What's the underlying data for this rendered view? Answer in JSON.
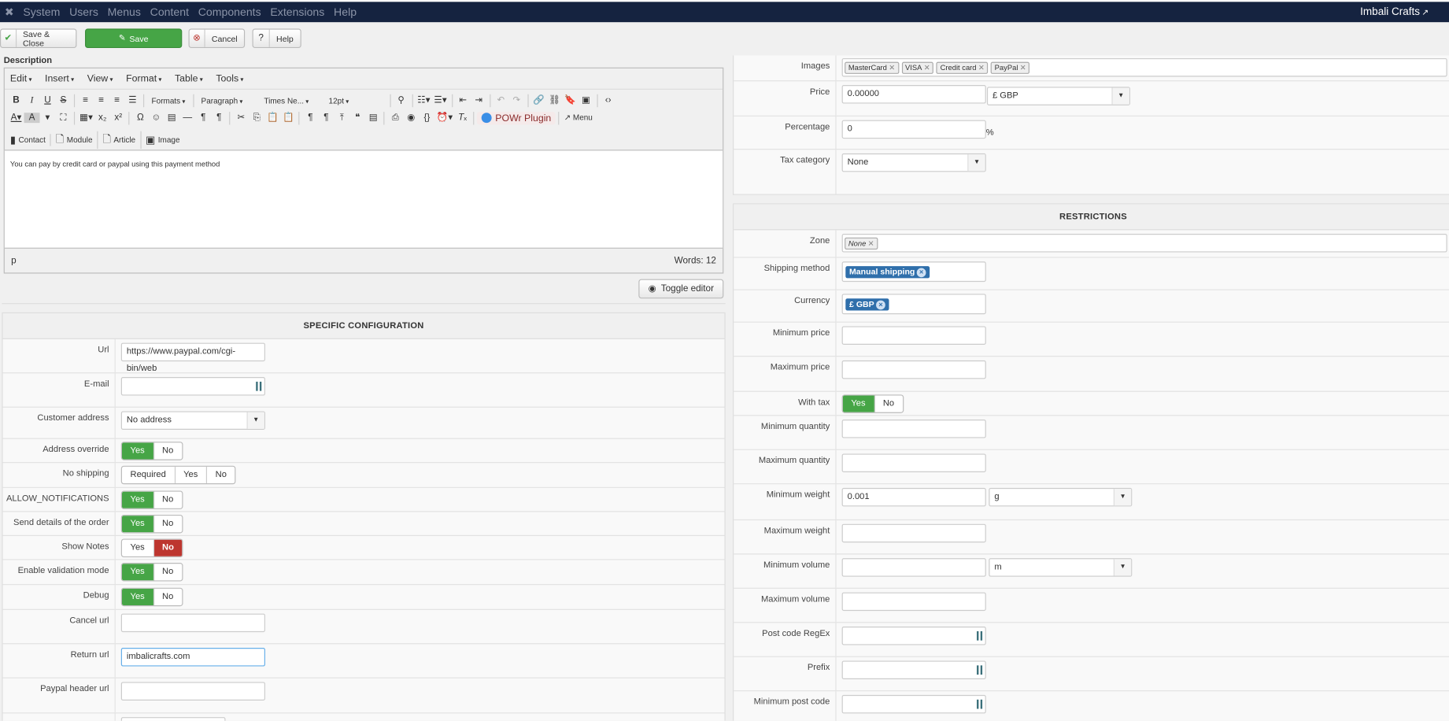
{
  "topbar": {
    "menu": [
      "System",
      "Users",
      "Menus",
      "Content",
      "Components",
      "Extensions",
      "Help"
    ],
    "site_name": "Imbali Crafts"
  },
  "toolbar": {
    "save_close": "Save & Close",
    "save": "Save",
    "cancel": "Cancel",
    "help": "Help"
  },
  "editor": {
    "label": "Description",
    "menu": [
      "Edit",
      "Insert",
      "View",
      "Format",
      "Table",
      "Tools"
    ],
    "formats": "Formats",
    "paragraph": "Paragraph",
    "font": "Times Ne...",
    "size": "12pt",
    "plugin": "POWr Plugin",
    "menu_btn": "Menu",
    "insert": [
      "Contact",
      "Module",
      "Article",
      "Image"
    ],
    "content": "You can pay by credit card or paypal using this payment method",
    "path": "p",
    "words": "Words: 12",
    "toggle": "Toggle editor"
  },
  "specific": {
    "title": "SPECIFIC CONFIGURATION",
    "url_label": "Url",
    "url_value": "https://www.paypal.com/cgi-bin/web",
    "email_label": "E-mail",
    "customer_address_label": "Customer address",
    "customer_address_value": "No address",
    "address_override_label": "Address override",
    "no_shipping_label": "No shipping",
    "no_shipping_options": [
      "Required",
      "Yes",
      "No"
    ],
    "allow_notifications_label": "ALLOW_NOTIFICATIONS",
    "send_details_label": "Send details of the order",
    "show_notes_label": "Show Notes",
    "validation_label": "Enable validation mode",
    "debug_label": "Debug",
    "cancel_url_label": "Cancel url",
    "return_url_label": "Return url",
    "return_url_value": "imbalicrafts.com",
    "header_url_label": "Paypal header url",
    "yes": "Yes",
    "no": "No"
  },
  "general": {
    "images_label": "Images",
    "images": [
      "MasterCard",
      "VISA",
      "Credit card",
      "PayPal"
    ],
    "price_label": "Price",
    "price_value": "0.00000",
    "price_currency": "£ GBP",
    "percentage_label": "Percentage",
    "percentage_value": "0",
    "percent_sign": "%",
    "tax_label": "Tax category",
    "tax_value": "None"
  },
  "restrictions": {
    "title": "RESTRICTIONS",
    "zone_label": "Zone",
    "zone_value": "None",
    "shipping_label": "Shipping method",
    "shipping_value": "Manual shipping",
    "currency_label": "Currency",
    "currency_value": "£ GBP",
    "min_price_label": "Minimum price",
    "max_price_label": "Maximum price",
    "with_tax_label": "With tax",
    "min_qty_label": "Minimum quantity",
    "max_qty_label": "Maximum quantity",
    "min_weight_label": "Minimum weight",
    "min_weight_value": "0.001",
    "weight_unit": "g",
    "max_weight_label": "Maximum weight",
    "min_volume_label": "Minimum volume",
    "volume_unit": "m",
    "max_volume_label": "Maximum volume",
    "postcode_regex_label": "Post code RegEx",
    "prefix_label": "Prefix",
    "min_postcode_label": "Minimum post code"
  },
  "colors": {
    "topbar": "#152340",
    "success": "#46a546",
    "danger": "#bd362f",
    "tag_blue": "#2f6fab"
  }
}
